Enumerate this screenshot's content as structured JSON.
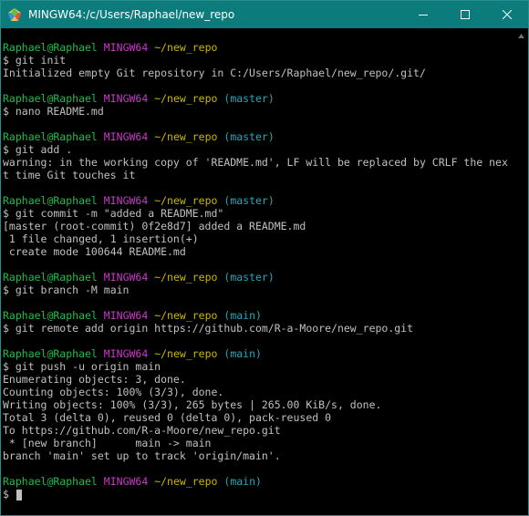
{
  "window": {
    "title": "MINGW64:/c/Users/Raphael/new_repo",
    "icon": "mingw-app-icon",
    "controls": [
      "minimize-icon",
      "maximize-icon",
      "close-icon"
    ]
  },
  "colors": {
    "titlebar": "#0b7b7b",
    "user_host": "#1fbd4a",
    "system": "#c83ac8",
    "path": "#c8b800",
    "branch": "#21a8b8",
    "text": "#c0c0c0"
  },
  "terminal": {
    "prompt": {
      "user_host": "Raphael@Raphael",
      "system": "MINGW64",
      "path": "~/new_repo"
    },
    "blocks": [
      {
        "branch": "",
        "command": "$ git init",
        "output": [
          "Initialized empty Git repository in C:/Users/Raphael/new_repo/.git/"
        ]
      },
      {
        "branch": "(master)",
        "command": "$ nano README.md",
        "output": []
      },
      {
        "branch": "(master)",
        "command": "$ git add .",
        "output": [
          "warning: in the working copy of 'README.md', LF will be replaced by CRLF the nex",
          "t time Git touches it"
        ]
      },
      {
        "branch": "(master)",
        "command": "$ git commit -m \"added a README.md\"",
        "output": [
          "[master (root-commit) 0f2e8d7] added a README.md",
          " 1 file changed, 1 insertion(+)",
          " create mode 100644 README.md"
        ]
      },
      {
        "branch": "(master)",
        "command": "$ git branch -M main",
        "output": []
      },
      {
        "branch": "(main)",
        "command": "$ git remote add origin https://github.com/R-a-Moore/new_repo.git",
        "output": []
      },
      {
        "branch": "(main)",
        "command": "$ git push -u origin main",
        "output": [
          "Enumerating objects: 3, done.",
          "Counting objects: 100% (3/3), done.",
          "Writing objects: 100% (3/3), 265 bytes | 265.00 KiB/s, done.",
          "Total 3 (delta 0), reused 0 (delta 0), pack-reused 0",
          "To https://github.com/R-a-Moore/new_repo.git",
          " * [new branch]      main -> main",
          "branch 'main' set up to track 'origin/main'."
        ]
      },
      {
        "branch": "(main)",
        "command": "$ ",
        "output": []
      }
    ]
  }
}
